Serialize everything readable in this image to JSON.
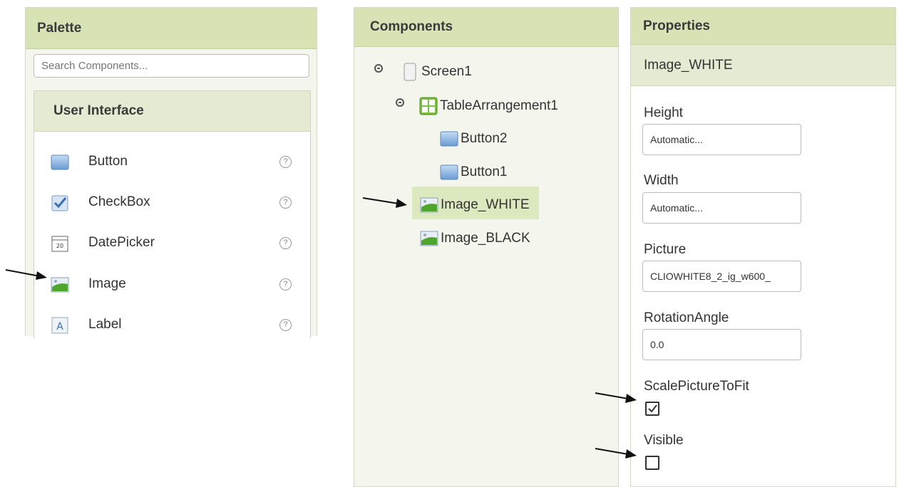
{
  "palette": {
    "title": "Palette",
    "search_placeholder": "Search Components...",
    "category": "User Interface",
    "items": [
      {
        "label": "Button",
        "icon": "button-icon"
      },
      {
        "label": "CheckBox",
        "icon": "checkbox-icon"
      },
      {
        "label": "DatePicker",
        "icon": "datepicker-icon"
      },
      {
        "label": "Image",
        "icon": "image-icon"
      },
      {
        "label": "Label",
        "icon": "label-icon"
      }
    ],
    "help_glyph": "?"
  },
  "components": {
    "title": "Components",
    "tree": [
      {
        "label": "Screen1",
        "icon": "screen-icon"
      },
      {
        "label": "TableArrangement1",
        "icon": "table-arrangement-icon"
      },
      {
        "label": "Button2",
        "icon": "button-icon"
      },
      {
        "label": "Button1",
        "icon": "button-icon"
      },
      {
        "label": "Image_WHITE",
        "icon": "image-icon",
        "selected": true
      },
      {
        "label": "Image_BLACK",
        "icon": "image-icon"
      }
    ]
  },
  "properties": {
    "title": "Properties",
    "component": "Image_WHITE",
    "fields": {
      "height": {
        "label": "Height",
        "value": "Automatic..."
      },
      "width": {
        "label": "Width",
        "value": "Automatic..."
      },
      "picture": {
        "label": "Picture",
        "value": "CLIOWHITE8_2_ig_w600_"
      },
      "rotation": {
        "label": "RotationAngle",
        "value": "0.0"
      },
      "scale": {
        "label": "ScalePictureToFit",
        "checked": true
      },
      "visible": {
        "label": "Visible",
        "checked": false
      }
    }
  },
  "colors": {
    "header": "#d7e3b5",
    "subheader": "#e4ebd2",
    "selection": "#dce8bd"
  }
}
